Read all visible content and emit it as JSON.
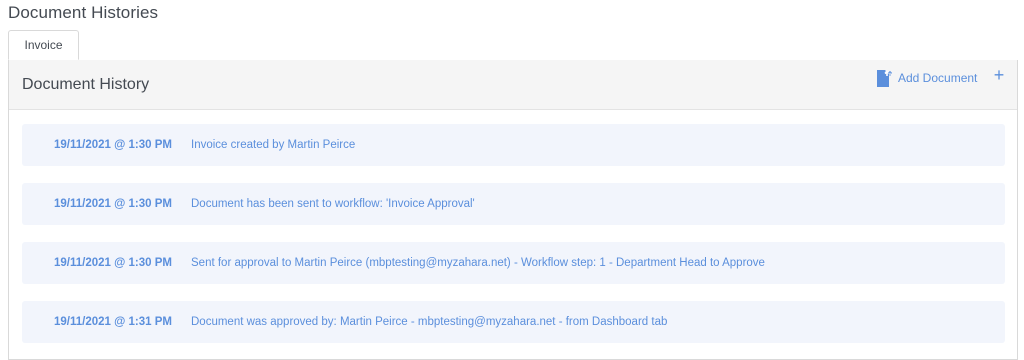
{
  "page": {
    "title": "Document Histories"
  },
  "tabs": [
    {
      "label": "Invoice",
      "active": true
    }
  ],
  "panel": {
    "title": "Document History",
    "add_document_label": "Add Document",
    "add_icon": "file-upload-icon",
    "plus_label": "+"
  },
  "history": [
    {
      "date": "19/11/2021 @ 1:30 PM",
      "text": "Invoice created by Martin Peirce"
    },
    {
      "date": "19/11/2021 @ 1:30 PM",
      "text": "Document has been sent to workflow: 'Invoice Approval'"
    },
    {
      "date": "19/11/2021 @ 1:30 PM",
      "text": "Sent for approval to Martin Peirce (mbptesting@myzahara.net) - Workflow step: 1 - Department Head to Approve"
    },
    {
      "date": "19/11/2021 @ 1:31 PM",
      "text": "Document was approved by: Martin Peirce - mbptesting@myzahara.net - from Dashboard tab"
    }
  ],
  "colors": {
    "accent": "#5b8fdc",
    "row_background": "#f2f5fc",
    "header_background": "#f5f5f5",
    "text": "#444a52"
  }
}
